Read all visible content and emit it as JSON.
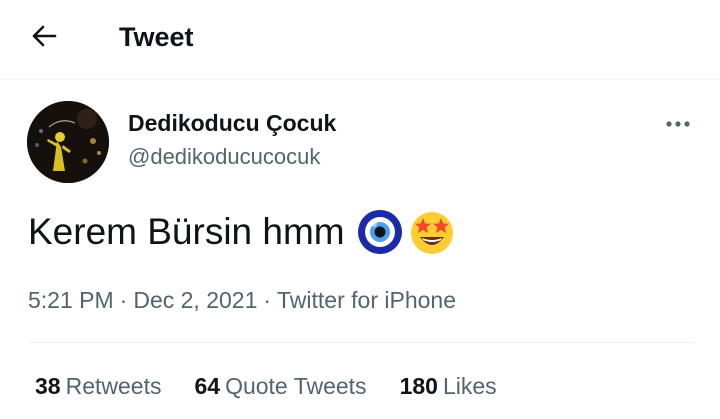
{
  "header": {
    "title": "Tweet",
    "back_icon": "arrow-left-icon"
  },
  "author": {
    "display_name": "Dedikoducu Çocuk",
    "handle": "@dedikoducucocuk",
    "avatar_icon": "avatar-image"
  },
  "tweet": {
    "text": "Kerem Bürsin hmm",
    "emojis": [
      "nazar-amulet-emoji",
      "star-struck-emoji"
    ],
    "time": "5:21 PM",
    "separator": "·",
    "date": "Dec 2, 2021",
    "source": "Twitter for iPhone"
  },
  "stats": [
    {
      "count": "38",
      "label": "Retweets"
    },
    {
      "count": "64",
      "label": "Quote Tweets"
    },
    {
      "count": "180",
      "label": "Likes"
    }
  ],
  "colors": {
    "text_primary": "#0f1419",
    "text_secondary": "#536471",
    "divider": "#eff3f4"
  }
}
